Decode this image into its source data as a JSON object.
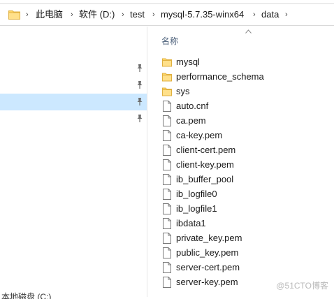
{
  "address_bar": {
    "breadcrumbs": [
      "此电脑",
      "软件 (D:)",
      "test",
      "mysql-5.7.35-winx64",
      "data"
    ]
  },
  "nav_pane": {
    "pinned_count": 4,
    "selected_index": 2,
    "drive_label": "本地磁盘 (C:)"
  },
  "content": {
    "column_header": "名称",
    "files": [
      {
        "name": "mysql",
        "type": "folder"
      },
      {
        "name": "performance_schema",
        "type": "folder"
      },
      {
        "name": "sys",
        "type": "folder"
      },
      {
        "name": "auto.cnf",
        "type": "file"
      },
      {
        "name": "ca.pem",
        "type": "file"
      },
      {
        "name": "ca-key.pem",
        "type": "file"
      },
      {
        "name": "client-cert.pem",
        "type": "file"
      },
      {
        "name": "client-key.pem",
        "type": "file"
      },
      {
        "name": "ib_buffer_pool",
        "type": "file"
      },
      {
        "name": "ib_logfile0",
        "type": "file"
      },
      {
        "name": "ib_logfile1",
        "type": "file"
      },
      {
        "name": "ibdata1",
        "type": "file"
      },
      {
        "name": "private_key.pem",
        "type": "file"
      },
      {
        "name": "public_key.pem",
        "type": "file"
      },
      {
        "name": "server-cert.pem",
        "type": "file"
      },
      {
        "name": "server-key.pem",
        "type": "file"
      }
    ]
  },
  "watermark": "@51CTO博客",
  "colors": {
    "folder": "#ffd766",
    "folder_dark": "#e8b33c",
    "selection": "#cce8ff",
    "header_text": "#4c607a"
  }
}
